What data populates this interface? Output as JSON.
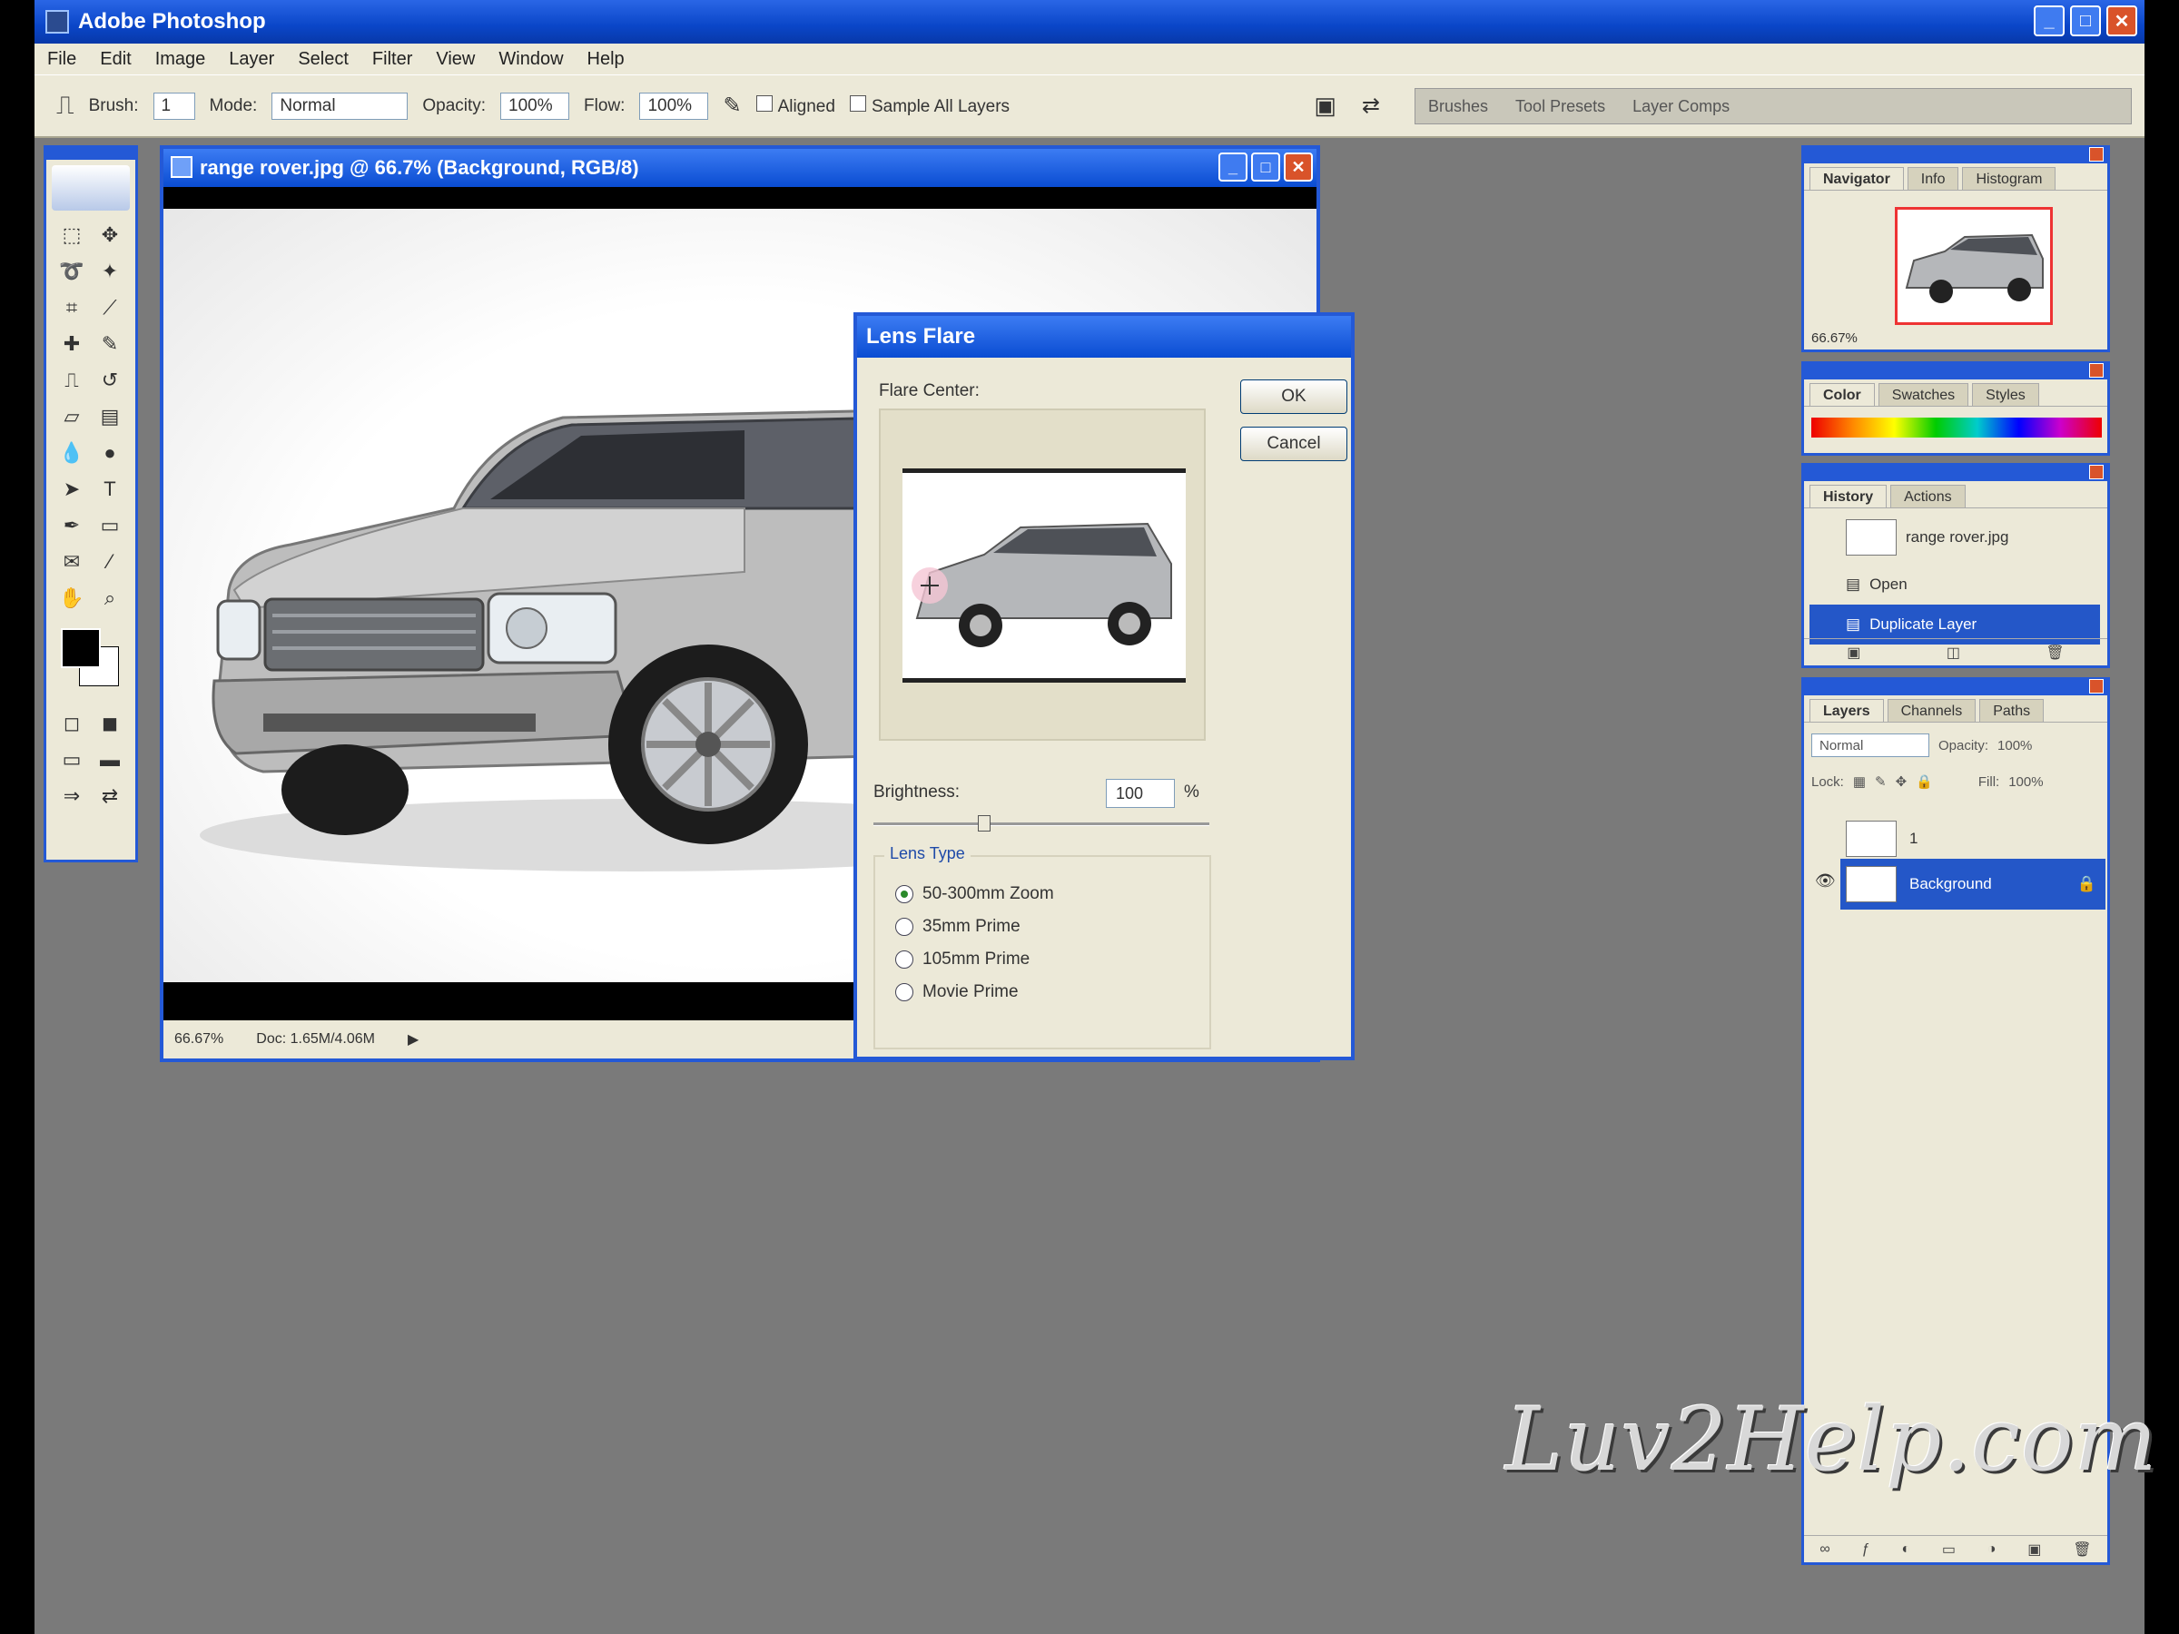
{
  "app": {
    "title": "Adobe Photoshop"
  },
  "menu": [
    "File",
    "Edit",
    "Image",
    "Layer",
    "Select",
    "Filter",
    "View",
    "Window",
    "Help"
  ],
  "options": {
    "brush_label": "Brush:",
    "brush_size": "1",
    "mode_label": "Mode:",
    "mode_value": "Normal",
    "opacity_label": "Opacity:",
    "opacity_value": "100%",
    "flow_label": "Flow:",
    "flow_value": "100%",
    "aligned_label": "Aligned",
    "sample_label": "Sample All Layers"
  },
  "palette_well": {
    "tabs": [
      "Brushes",
      "Tool Presets",
      "Layer Comps"
    ]
  },
  "document": {
    "title": "range rover.jpg @ 66.7% (Background, RGB/8)",
    "zoom": "66.67%",
    "doc_size": "Doc: 1.65M/4.06M"
  },
  "dialog": {
    "title": "Lens Flare",
    "flare_center_label": "Flare Center:",
    "ok_label": "OK",
    "cancel_label": "Cancel",
    "brightness_label": "Brightness:",
    "brightness_value": "100",
    "brightness_unit": "%",
    "brightness_slider_fraction": 0.33,
    "lens_type_label": "Lens Type",
    "lens_types": [
      {
        "label": "50-300mm Zoom",
        "selected": true
      },
      {
        "label": "35mm Prime",
        "selected": false
      },
      {
        "label": "105mm Prime",
        "selected": false
      },
      {
        "label": "Movie Prime",
        "selected": false
      }
    ]
  },
  "navigator": {
    "tabs": [
      "Navigator",
      "Info",
      "Histogram"
    ],
    "zoom": "66.67%"
  },
  "color_palette": {
    "tabs": [
      "Color",
      "Swatches",
      "Styles"
    ]
  },
  "history": {
    "tabs": [
      "History",
      "Actions"
    ],
    "snapshot": "range rover.jpg",
    "items": [
      {
        "label": "Open",
        "selected": false
      },
      {
        "label": "Duplicate Layer",
        "selected": true
      }
    ]
  },
  "layers": {
    "tabs": [
      "Layers",
      "Channels",
      "Paths"
    ],
    "mode": "Normal",
    "opacity_label": "Opacity:",
    "opacity": "100%",
    "lock_label": "Lock:",
    "fill_label": "Fill:",
    "fill": "100%",
    "items": [
      {
        "label": "1",
        "selected": false
      },
      {
        "label": "Background",
        "selected": true
      }
    ]
  },
  "watermark": "Luv2Help.com",
  "colors": {
    "titlebar": "#0a46c8",
    "workspace": "#7a7a7a",
    "panel": "#ece9d8",
    "selection": "#2457c8"
  }
}
